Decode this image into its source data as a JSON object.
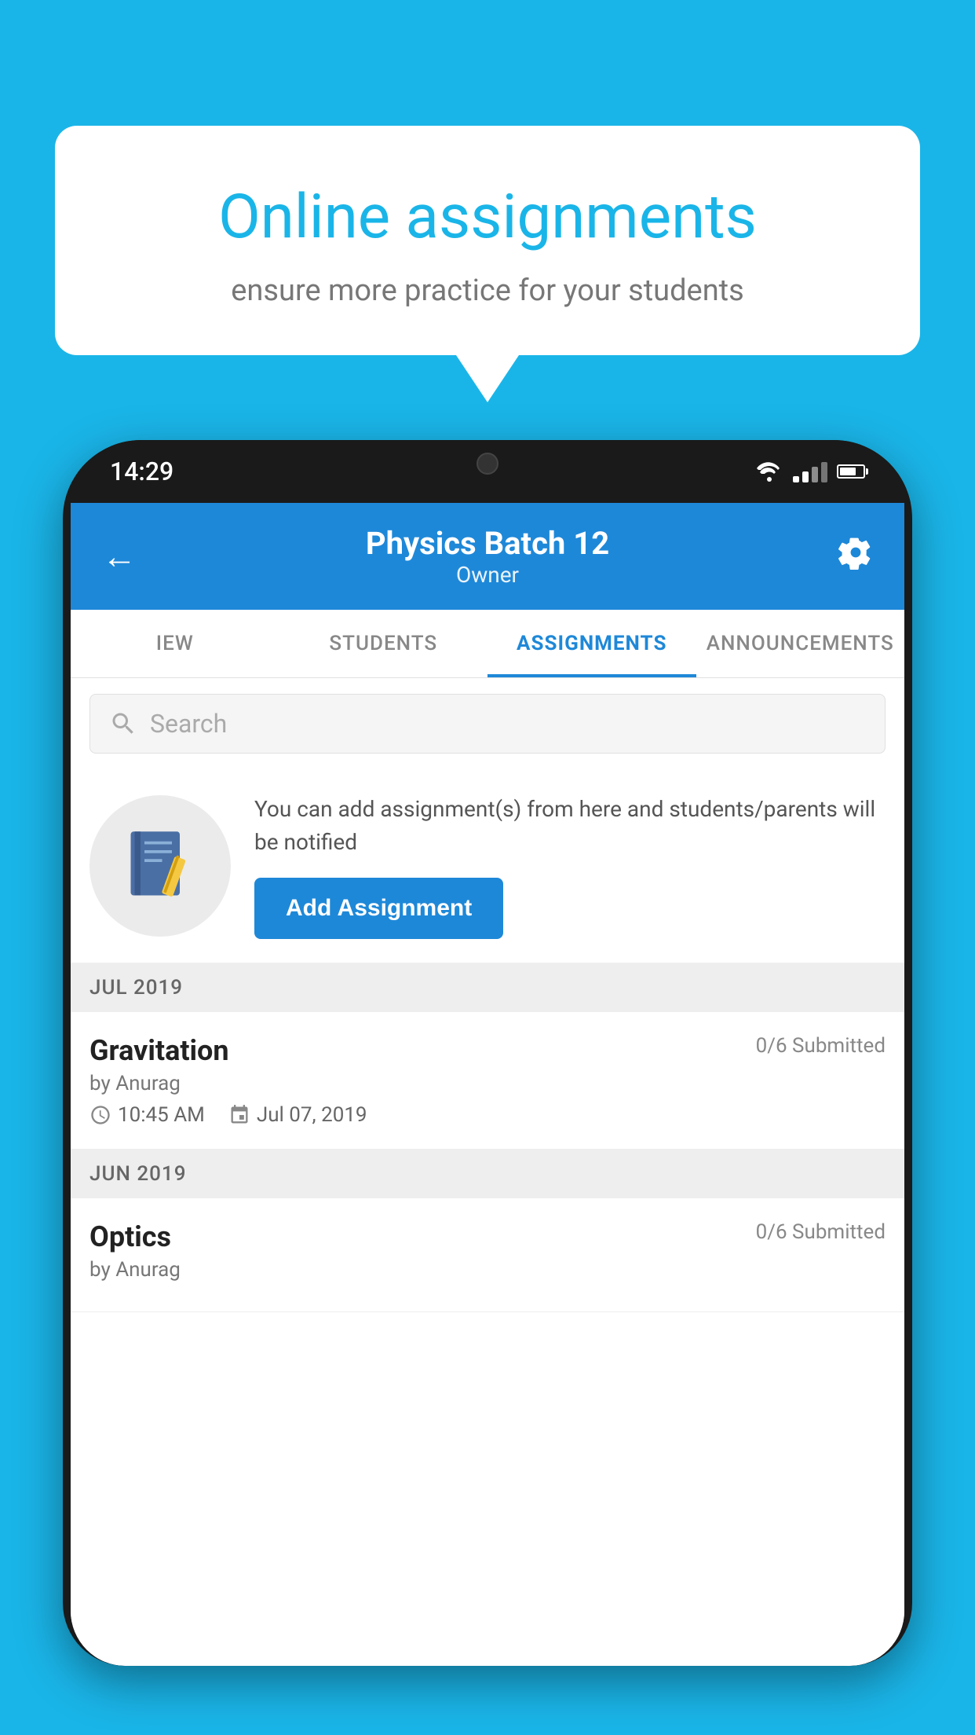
{
  "background_color": "#1ab5e8",
  "speech_bubble": {
    "title": "Online assignments",
    "subtitle": "ensure more practice for your students"
  },
  "phone": {
    "time": "14:29",
    "header": {
      "title": "Physics Batch 12",
      "subtitle": "Owner",
      "back_label": "←",
      "settings_label": "⚙"
    },
    "tabs": [
      {
        "label": "IEW",
        "active": false
      },
      {
        "label": "STUDENTS",
        "active": false
      },
      {
        "label": "ASSIGNMENTS",
        "active": true
      },
      {
        "label": "ANNOUNCEMENTS",
        "active": false
      }
    ],
    "search": {
      "placeholder": "Search"
    },
    "promo": {
      "text": "You can add assignment(s) from here and students/parents will be notified",
      "button_label": "Add Assignment"
    },
    "sections": [
      {
        "header": "JUL 2019",
        "assignments": [
          {
            "name": "Gravitation",
            "submitted": "0/6 Submitted",
            "by": "by Anurag",
            "time": "10:45 AM",
            "date": "Jul 07, 2019"
          }
        ]
      },
      {
        "header": "JUN 2019",
        "assignments": [
          {
            "name": "Optics",
            "submitted": "0/6 Submitted",
            "by": "by Anurag",
            "time": "",
            "date": ""
          }
        ]
      }
    ]
  }
}
